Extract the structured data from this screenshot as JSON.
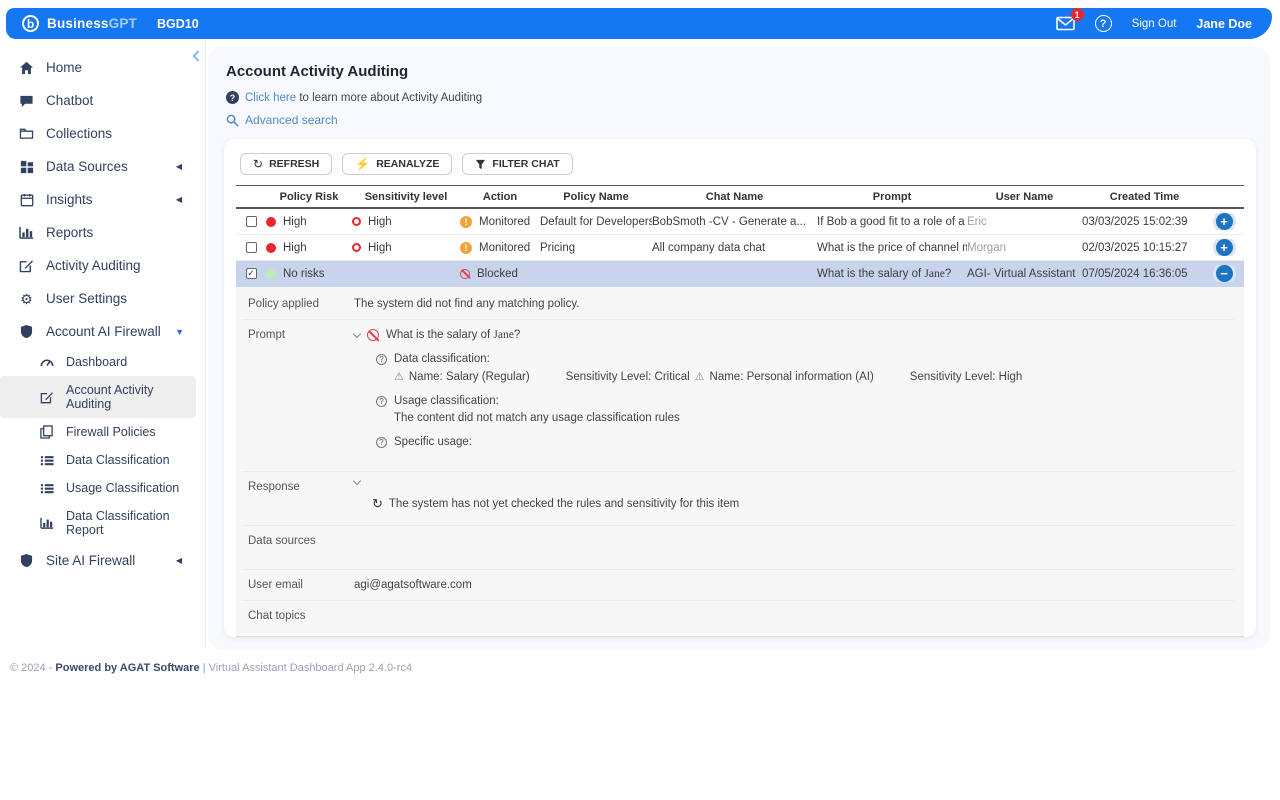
{
  "colors": {
    "header_blue": "#1677F2",
    "link_blue": "#4E8BC9",
    "sidebar_navy": "#31415F",
    "risk_red": "#E8262C",
    "monitored_amber": "#F2A33C",
    "blocked_red": "#E04250",
    "no_risk_green": "#BDEBB5",
    "selected_row_bg": "#C8D4EC",
    "expand_button_blue": "#1E73C2"
  },
  "header": {
    "logo_letter": "b",
    "brand_bold": "Business",
    "brand_light": "GPT",
    "env_label": "BGD10",
    "mail_badge": "1",
    "help_symbol": "?",
    "sign_out": "Sign Out",
    "user_name": "Jane Doe"
  },
  "sidebar": {
    "items": [
      {
        "label": "Home"
      },
      {
        "label": "Chatbot"
      },
      {
        "label": "Collections"
      },
      {
        "label": "Data Sources"
      },
      {
        "label": "Insights"
      },
      {
        "label": "Reports"
      },
      {
        "label": "Activity Auditing"
      },
      {
        "label": "User Settings"
      },
      {
        "label": "Account AI Firewall"
      },
      {
        "label": "Dashboard"
      },
      {
        "label": "Account Activity Auditing"
      },
      {
        "label": "Firewall Policies"
      },
      {
        "label": "Data Classification"
      },
      {
        "label": "Usage Classification"
      },
      {
        "label": "Data Classification Report"
      },
      {
        "label": "Site AI Firewall"
      }
    ]
  },
  "page": {
    "title": "Account Activity Auditing",
    "help_link": "Click here",
    "help_rest": " to learn more about Activity Auditing",
    "advanced_search": "Advanced search"
  },
  "toolbar": {
    "refresh": "REFRESH",
    "reanalyze": "REANALYZE",
    "filter_chat": "FILTER CHAT"
  },
  "table": {
    "columns": [
      "Policy Risk",
      "Sensitivity level",
      "Action",
      "Policy Name",
      "Chat Name",
      "Prompt",
      "User Name",
      "Created Time"
    ],
    "rows": [
      {
        "risk": "High",
        "sensitivity": "High",
        "action": "Monitored",
        "policy": "Default for Developers",
        "chat": "BobSmoth -CV - Generate a...",
        "prompt": "If Bob a good fit to a role of a su...",
        "user": "Eric",
        "created": "03/03/2025 15:02:39"
      },
      {
        "risk": "High",
        "sensitivity": "High",
        "action": "Monitored",
        "policy": "Pricing",
        "chat": "All company data chat",
        "prompt": "What is the price of channel ma...",
        "user": "Morgan",
        "created": "02/03/2025 10:15:27"
      },
      {
        "risk": "No risks",
        "action": "Blocked",
        "prompt_prefix": "What is the salary of ",
        "prompt_name": "Jane",
        "prompt_suffix": "?",
        "user": "AGI- Virtual Assistant",
        "created": "07/05/2024 16:36:05"
      }
    ]
  },
  "details": {
    "policy_applied": {
      "label": "Policy applied",
      "value": "The system did not find any matching policy."
    },
    "prompt": {
      "label": "Prompt",
      "text_prefix": "What is the salary of ",
      "text_name": "Jane",
      "text_suffix": "?",
      "data_classification_label": "Data classification:",
      "classifications": [
        {
          "name": "Name: Salary (Regular)",
          "level": "Sensitivity Level: Critical"
        },
        {
          "name": "Name: Personal information (AI)",
          "level": "Sensitivity Level: High"
        }
      ],
      "usage_classification_label": "Usage classification:",
      "usage_classification_value": "The content did not match any usage classification rules",
      "specific_usage_label": "Specific usage:"
    },
    "response": {
      "label": "Response",
      "value": "The system has not yet checked the rules and sensitivity for this item"
    },
    "data_sources_label": "Data sources",
    "user_email": {
      "label": "User email",
      "value": "agi@agatsoftware.com"
    },
    "chat_topics_label": "Chat topics"
  },
  "footer": {
    "prefix": "© 2024 - ",
    "bold": "Powered by AGAT Software",
    "suffix": " | Virtual Assistant Dashboard App 2.4.0-rc4"
  }
}
